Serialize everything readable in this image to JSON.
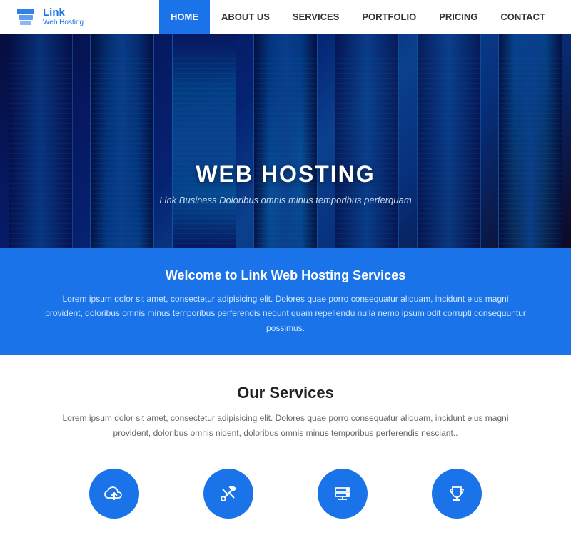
{
  "logo": {
    "name": "Link",
    "sub": "Web Hosting"
  },
  "nav": {
    "items": [
      {
        "label": "HOME",
        "active": true
      },
      {
        "label": "ABOUT US",
        "active": false
      },
      {
        "label": "SERVICES",
        "active": false
      },
      {
        "label": "PORTFOLIO",
        "active": false
      },
      {
        "label": "PRICING",
        "active": false
      },
      {
        "label": "CONTACT",
        "active": false
      }
    ]
  },
  "hero": {
    "title": "WEB HOSTING",
    "subtitle": "Link Business Doloribus omnis minus temporibus perferquam"
  },
  "banner": {
    "heading": "Welcome to Link Web Hosting Services",
    "body": "Lorem ipsum dolor sit amet, consectetur adipisicing elit. Dolores quae porro consequatur aliquam, incidunt eius magni provident, doloribus omnis minus temporibus perferendis nequnt quam repellendu nulla nemo ipsum odit corrupti consequuntur possimus."
  },
  "services": {
    "heading": "Our Services",
    "body": "Lorem ipsum dolor sit amet, consectetur adipisicing elit. Dolores quae porro consequatur aliquam, incidunt eius magni provident, doloribus omnis nident, doloribus omnis minus temporibus perferendis nesciant..",
    "icons": [
      {
        "name": "cloud-upload",
        "label": "Cloud"
      },
      {
        "name": "tools",
        "label": "Tools"
      },
      {
        "name": "server",
        "label": "Server"
      },
      {
        "name": "trophy",
        "label": "Trophy"
      }
    ]
  },
  "colors": {
    "primary": "#1a73e8",
    "dark": "#222",
    "light_text": "#fff",
    "muted": "#666"
  }
}
